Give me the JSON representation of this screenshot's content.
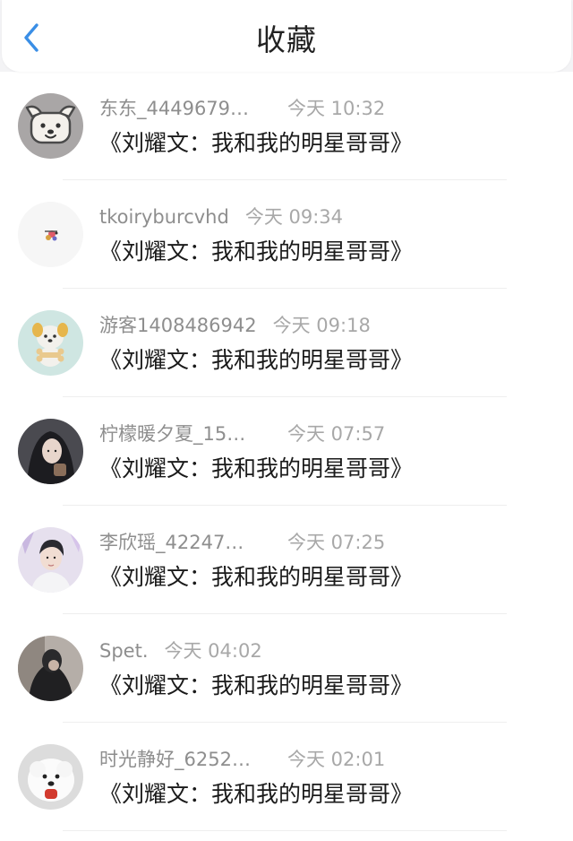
{
  "header": {
    "title": "收藏",
    "back_icon": "chevron-left-icon",
    "accent_color": "#3a8ee6"
  },
  "items": [
    {
      "name": "东东_4449679…",
      "time": "今天 10:32",
      "content": "《刘耀文：我和我的明星哥哥》",
      "avatar": "puppy-face"
    },
    {
      "name": "tkoiryburcvhd",
      "time": "今天 09:34",
      "content": "《刘耀文：我和我的明星哥哥》",
      "avatar": "tiny-sticker"
    },
    {
      "name": "游客1408486942",
      "time": "今天 09:18",
      "content": "《刘耀文：我和我的明星哥哥》",
      "avatar": "dog-with-bone"
    },
    {
      "name": "柠檬暖夕夏_15…",
      "time": "今天 07:57",
      "content": "《刘耀文：我和我的明星哥哥》",
      "avatar": "dark-hair-portrait"
    },
    {
      "name": "李欣瑶_42247…",
      "time": "今天 07:25",
      "content": "《刘耀文：我和我的明星哥哥》",
      "avatar": "boy-portrait"
    },
    {
      "name": "Spet.",
      "time": "今天 04:02",
      "content": "《刘耀文：我和我的明星哥哥》",
      "avatar": "dark-photo"
    },
    {
      "name": "时光静好_6252…",
      "time": "今天 02:01",
      "content": "《刘耀文：我和我的明星哥哥》",
      "avatar": "white-dog"
    }
  ]
}
